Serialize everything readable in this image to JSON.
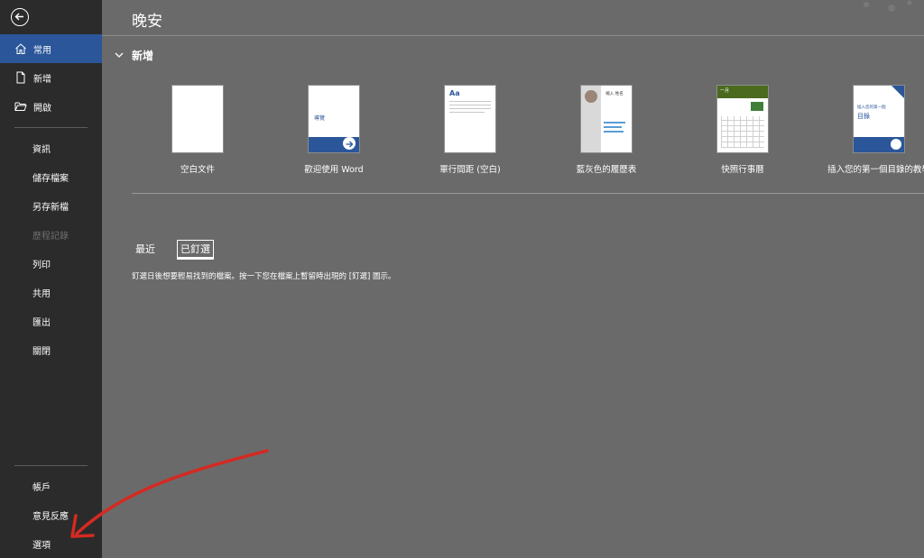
{
  "sidebar": {
    "top": [
      {
        "label": "常用",
        "icon": "home-icon"
      },
      {
        "label": "新增",
        "icon": "new-document-icon"
      },
      {
        "label": "開啟",
        "icon": "open-folder-icon"
      }
    ],
    "middle": [
      {
        "label": "資訊"
      },
      {
        "label": "儲存檔案"
      },
      {
        "label": "另存新檔"
      },
      {
        "label": "歷程記錄",
        "disabled": true
      },
      {
        "label": "列印"
      },
      {
        "label": "共用"
      },
      {
        "label": "匯出"
      },
      {
        "label": "關閉"
      }
    ],
    "bottom": [
      {
        "label": "帳戶"
      },
      {
        "label": "意見反應"
      },
      {
        "label": "選項"
      }
    ]
  },
  "main": {
    "title": "晚安",
    "new_section": "新增",
    "templates": [
      {
        "name": "空白文件"
      },
      {
        "name": "歡迎使用 Word",
        "thumb_text": "導覽"
      },
      {
        "name": "單行間距 (空白)",
        "thumb_text": "Aa"
      },
      {
        "name": "藍灰色的履歷表",
        "thumb_text": "縮入 姓名"
      },
      {
        "name": "快照行事曆",
        "thumb_text": "一月"
      },
      {
        "name": "插入您的第一個目錄的教學",
        "thumb_text": "插入您的第一個",
        "thumb_text2": "目錄"
      }
    ],
    "tabs": [
      "最近",
      "已釘選"
    ],
    "pinned_hint": "釘選日後想要輕易找到的檔案。按一下您在檔案上暫留時出現的 [釘選] 圖示。"
  },
  "colors": {
    "sidebar": "#2b2b2b",
    "active": "#2b579a",
    "background": "#6a6a6a",
    "annotation_arrow": "#d42a22"
  }
}
